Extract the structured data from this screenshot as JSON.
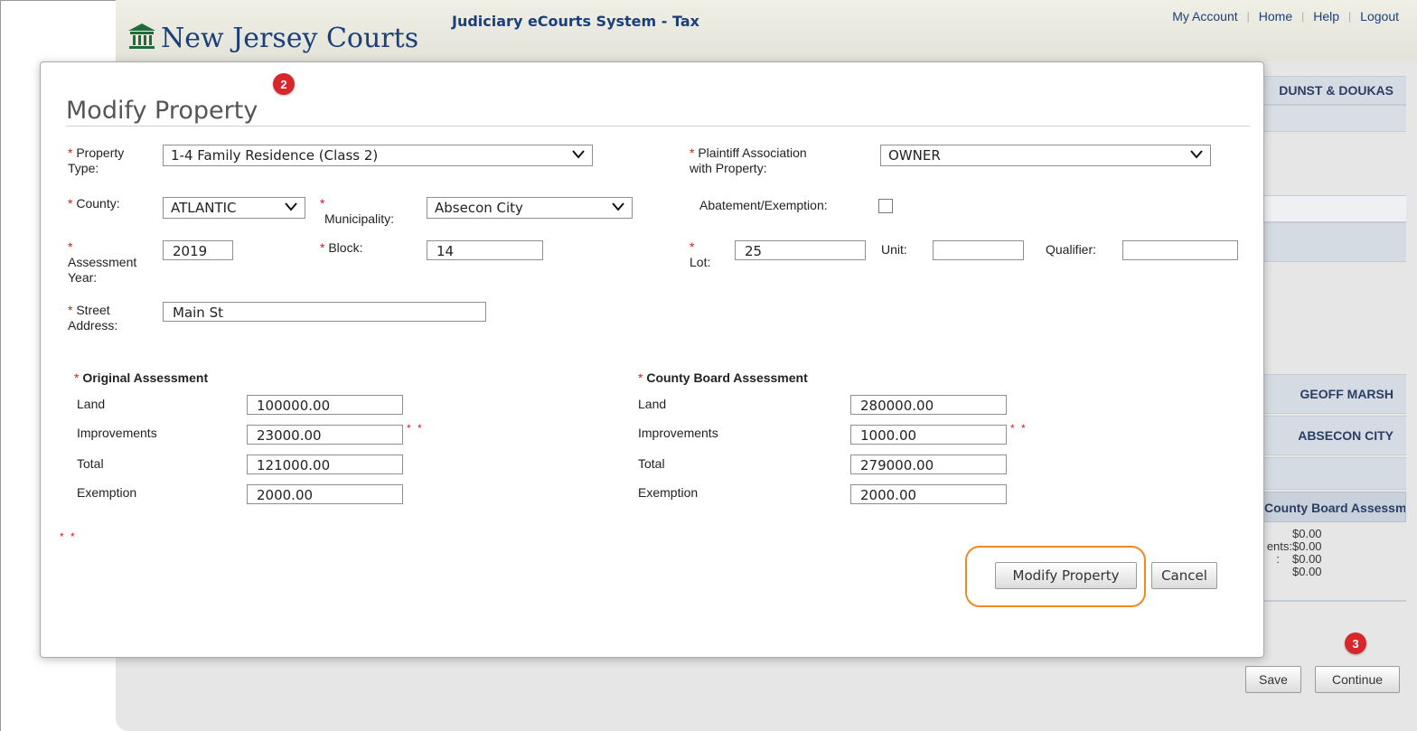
{
  "header": {
    "system_title": "Judiciary eCourts System - Tax",
    "logo_text": "New Jersey Courts",
    "links": [
      "My Account",
      "Home",
      "Help",
      "Logout"
    ]
  },
  "background": {
    "labels": {
      "firm": "DUNST & DOUKAS",
      "person": "GEOFF MARSH",
      "municipality": "ABSECON CITY",
      "assessment_header": "County Board Assessment"
    },
    "values": [
      {
        "prefix": "",
        "value": "$0.00"
      },
      {
        "prefix": "ents:",
        "value": "$0.00"
      },
      {
        "prefix": ":",
        "value": "$0.00"
      },
      {
        "prefix": "",
        "value": "$0.00"
      }
    ],
    "buttons": {
      "save": "Save",
      "continue": "Continue"
    },
    "badge_3": "3"
  },
  "modal": {
    "title": "Modify Property",
    "badge_2": "2",
    "required_mark": "*",
    "fields": {
      "property_type": {
        "label_1": "Property",
        "label_2": "Type:",
        "value": "1-4 Family Residence (Class 2)"
      },
      "plaintiff_association": {
        "label_1": "Plaintiff Association",
        "label_2": "with Property:",
        "value": "OWNER"
      },
      "county": {
        "label": "County:",
        "value": "ATLANTIC"
      },
      "municipality": {
        "label": "Municipality:",
        "value": "Absecon City"
      },
      "abatement": {
        "label": "Abatement/Exemption:",
        "checked": false
      },
      "assessment_year": {
        "label_1": "Assessment",
        "label_2": "Year:",
        "value": "2019"
      },
      "block": {
        "label": "Block:",
        "value": "14"
      },
      "lot": {
        "label": "Lot:",
        "value": "25"
      },
      "unit": {
        "label": "Unit:",
        "value": ""
      },
      "qualifier": {
        "label": "Qualifier:",
        "value": ""
      },
      "street_address": {
        "label_1": "Street",
        "label_2": "Address:",
        "value": "Main St"
      }
    },
    "original_assessment": {
      "title": "Original Assessment",
      "rows": [
        {
          "label": "Land",
          "value": "100000.00"
        },
        {
          "label": "Improvements",
          "value": "23000.00"
        },
        {
          "label": "Total",
          "value": "121000.00"
        },
        {
          "label": "Exemption",
          "value": "2000.00"
        }
      ]
    },
    "county_board_assessment": {
      "title": "County Board Assessment",
      "rows": [
        {
          "label": "Land",
          "value": "280000.00"
        },
        {
          "label": "Improvements",
          "value": "1000.00"
        },
        {
          "label": "Total",
          "value": "279000.00"
        },
        {
          "label": "Exemption",
          "value": "2000.00"
        }
      ]
    },
    "footnote_mark": "* *",
    "buttons": {
      "modify": "Modify Property",
      "cancel": "Cancel"
    }
  },
  "colors": {
    "accent": "#1b3f7a",
    "required": "#d21c1c",
    "badge": "#d9262a",
    "highlight": "#ee8a22"
  }
}
